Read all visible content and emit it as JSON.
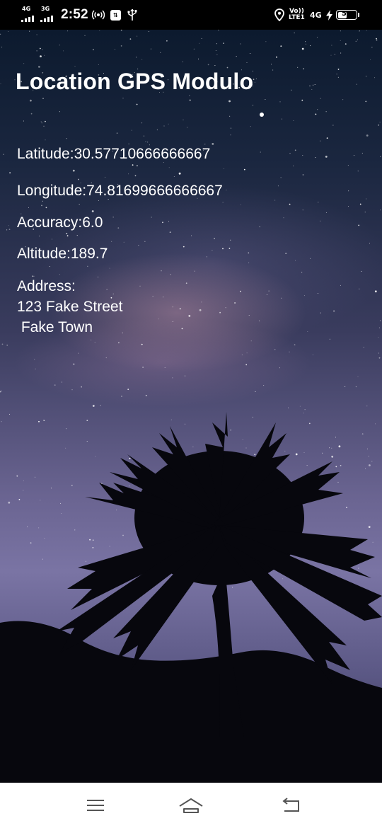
{
  "status_bar": {
    "sim1_network": "4G",
    "sim2_network": "3G",
    "time": "2:52",
    "hotspot_icon": "hotspot-icon",
    "data_saver_icon": "data-icon",
    "usb_icon": "usb-icon",
    "location_icon": "location-icon",
    "volte_top": "Vo))",
    "volte_bottom": "LTE1",
    "network_label": "4G",
    "charging_icon": "bolt-icon",
    "battery_level": "54",
    "battery_fraction": 0.54
  },
  "app": {
    "title": "Location GPS Modulo"
  },
  "location": {
    "latitude": "Latitude:30.57710666666667",
    "longitude": "Longitude:74.81699666666667",
    "accuracy": "Accuracy:6.0",
    "altitude": "Altitude:189.7",
    "address_label": "Address:",
    "address_line1": "123 Fake Street",
    "address_line2": " Fake Town"
  },
  "nav_bar": {
    "menu_icon": "menu-icon",
    "home_icon": "home-icon",
    "back_icon": "back-icon"
  },
  "colors": {
    "text": "#ffffff",
    "status_bar": "#000000",
    "nav_bar": "#ffffff",
    "nav_icons": "#555555",
    "sky_top": "#0c1a2e",
    "sky_bottom": "#7a74a4"
  }
}
